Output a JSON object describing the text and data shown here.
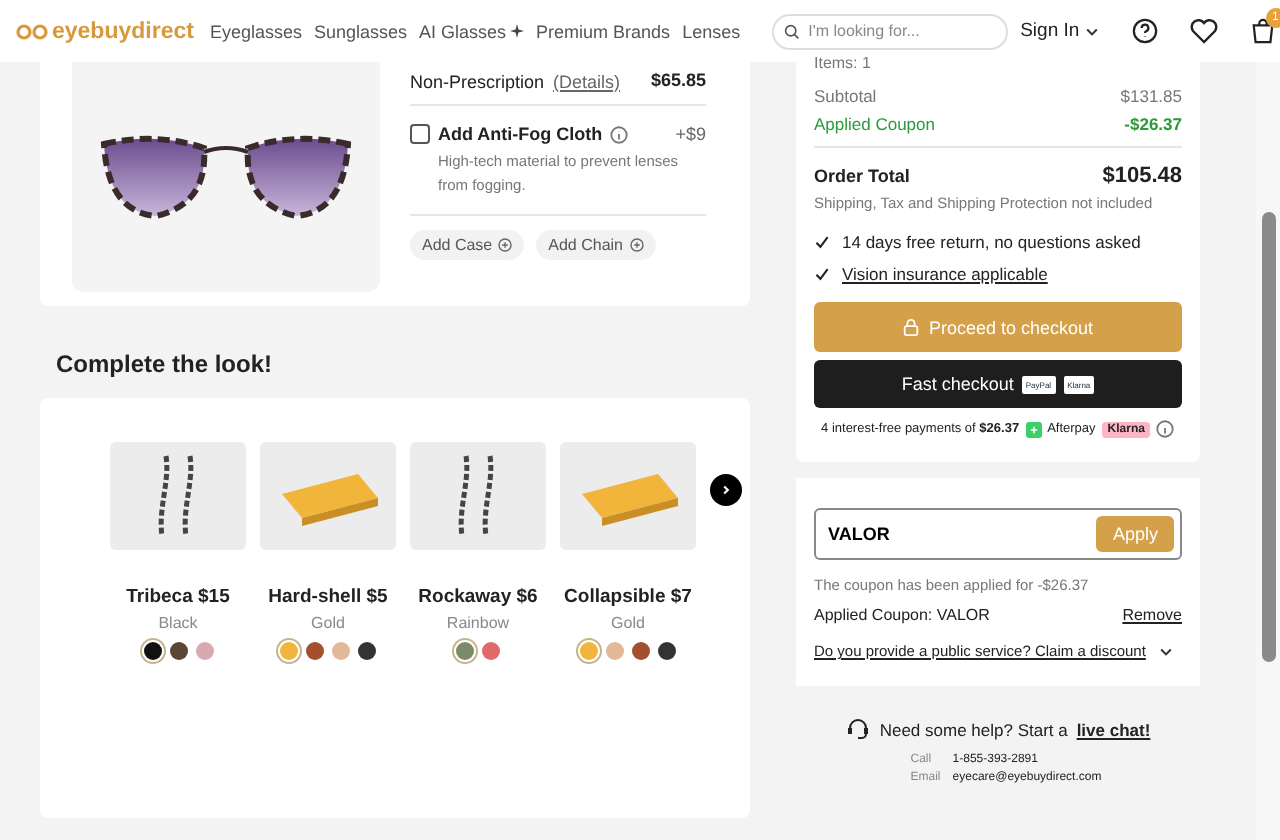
{
  "header": {
    "logo": "eyebuydirect",
    "nav": [
      {
        "label": "Eyeglasses",
        "sparkle": false
      },
      {
        "label": "Sunglasses",
        "sparkle": false
      },
      {
        "label": "AI Glasses",
        "sparkle": true
      },
      {
        "label": "Premium Brands",
        "sparkle": false
      },
      {
        "label": "Lenses",
        "sparkle": false
      }
    ],
    "search": {
      "placeholder": "I'm looking for..."
    },
    "sign_in": "Sign In",
    "cart_count": "1"
  },
  "product": {
    "option": "Non-Prescription",
    "details_link": "(Details)",
    "price": "$65.85",
    "addon": {
      "label": "Add Anti-Fog Cloth",
      "checked": false,
      "price": "+$9",
      "description": "High-tech material to prevent lenses from fogging."
    },
    "extras": [
      "Add Case",
      "Add Chain"
    ]
  },
  "recommendations": {
    "title": "Complete the look!",
    "items": [
      {
        "name": "Tribeca $15",
        "color_name": "Black",
        "kind": "chain",
        "swatches": [
          {
            "color": "#111111",
            "selected": true
          },
          {
            "color": "#5a4636",
            "selected": false
          },
          {
            "color": "#d9a9b0",
            "selected": false
          }
        ]
      },
      {
        "name": "Hard-shell $5",
        "color_name": "Gold",
        "kind": "case",
        "swatches": [
          {
            "color": "#f0b53a",
            "selected": true
          },
          {
            "color": "#a4502e",
            "selected": false
          },
          {
            "color": "#e2b899",
            "selected": false
          },
          {
            "color": "#333333",
            "selected": false
          }
        ]
      },
      {
        "name": "Rockaway $6",
        "color_name": "Rainbow",
        "kind": "chain",
        "swatches": [
          {
            "color": "#7b8a6a",
            "selected": true
          },
          {
            "color": "#e06a6a",
            "selected": false
          }
        ]
      },
      {
        "name": "Collapsible $7",
        "color_name": "Gold",
        "kind": "case",
        "swatches": [
          {
            "color": "#f0b53a",
            "selected": true
          },
          {
            "color": "#e2b899",
            "selected": false
          },
          {
            "color": "#a4502e",
            "selected": false
          },
          {
            "color": "#333333",
            "selected": false
          }
        ]
      }
    ]
  },
  "summary": {
    "items": "Items: 1",
    "subtotal": {
      "label": "Subtotal",
      "value": "$131.85"
    },
    "coupon": {
      "label": "Applied Coupon",
      "value": "-$26.37"
    },
    "total": {
      "label": "Order Total",
      "value": "$105.48"
    },
    "note": "Shipping, Tax and Shipping Protection not included",
    "benefits": [
      {
        "text": "14 days free return, no questions asked",
        "link": false
      },
      {
        "text": "Vision insurance applicable",
        "link": true
      }
    ],
    "checkout": "Proceed to checkout",
    "fast_checkout": "Fast checkout",
    "paypal": "PayPal",
    "klarna_logo": "Klarna",
    "installments": {
      "text": "4 interest-free payments of",
      "amount": "$26.37",
      "afterpay": "Afterpay",
      "klarna": "Klarna"
    }
  },
  "coupon": {
    "value": "VALOR",
    "apply": "Apply",
    "message": "The coupon has been applied for -$26.37",
    "applied": "Applied Coupon: VALOR",
    "remove": "Remove",
    "public_service": "Do you provide a public service? Claim a discount"
  },
  "help": {
    "text": "Need some help? Start a",
    "link": "live chat!",
    "call_label": "Call",
    "phone": "1-855-393-2891",
    "email_label": "Email",
    "email": "eyecare@eyebuydirect.com"
  }
}
